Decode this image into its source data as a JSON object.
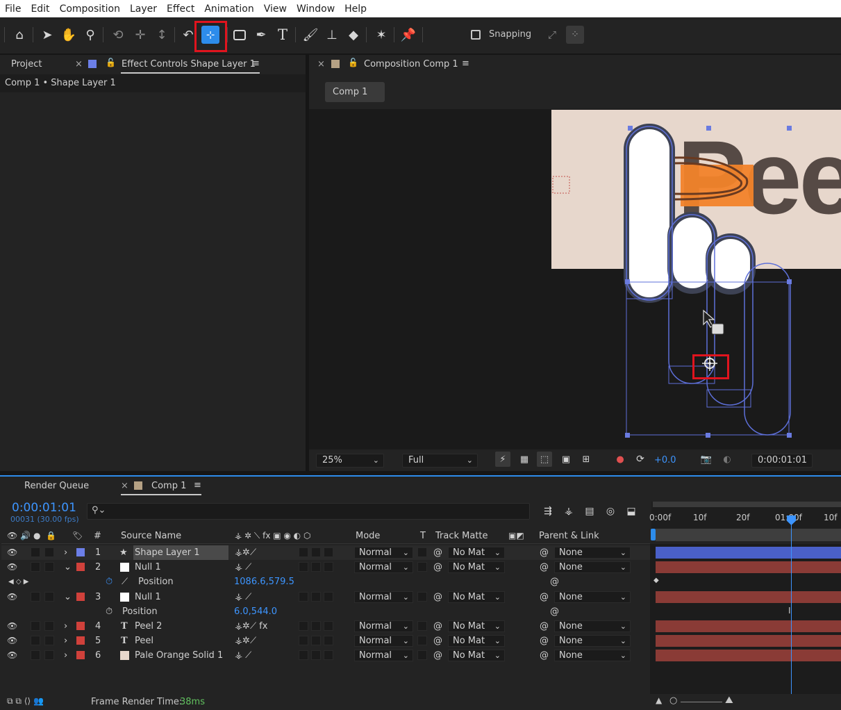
{
  "menu": [
    "File",
    "Edit",
    "Composition",
    "Layer",
    "Effect",
    "Animation",
    "View",
    "Window",
    "Help"
  ],
  "toolbar": {
    "snapping_label": "Snapping"
  },
  "left_panel": {
    "tab_project": "Project",
    "tab_effect_controls": "Effect Controls Shape Layer 1",
    "subtitle": "Comp 1 • Shape Layer 1"
  },
  "comp_panel": {
    "tab_label": "Composition Comp 1",
    "breadcrumb": "Comp 1",
    "canvas_text": "Peel",
    "zoom": "25%",
    "resolution": "Full",
    "exposure": "+0.0",
    "timecode": "0:00:01:01"
  },
  "timeline": {
    "tab_render_queue": "Render Queue",
    "tab_comp": "Comp 1",
    "timecode": "0:00:01:01",
    "frame_info": "00031 (30.00 fps)",
    "ruler": [
      "0:00f",
      "10f",
      "20f",
      "01:00f",
      "10f"
    ],
    "headers": {
      "num": "#",
      "source_name": "Source Name",
      "mode": "Mode",
      "t": "T",
      "track_matte": "Track Matte",
      "parent": "Parent & Link"
    },
    "layers": [
      {
        "num": "1",
        "name": "Shape Layer 1",
        "label_color": "#6c7fe8",
        "mode": "Normal",
        "matte": "No Mat",
        "parent": "None"
      },
      {
        "num": "2",
        "name": "Null 1",
        "label_color": "#d0413b",
        "mode": "Normal",
        "matte": "No Mat",
        "parent": "None"
      },
      {
        "num": "3",
        "name": "Null 1",
        "label_color": "#d0413b",
        "mode": "Normal",
        "matte": "No Mat",
        "parent": "None"
      },
      {
        "num": "4",
        "name": "Peel 2",
        "label_color": "#d0413b",
        "mode": "Normal",
        "matte": "No Mat",
        "parent": "None"
      },
      {
        "num": "5",
        "name": "Peel",
        "label_color": "#d0413b",
        "mode": "Normal",
        "matte": "No Mat",
        "parent": "None"
      },
      {
        "num": "6",
        "name": "Pale Orange Solid 1",
        "label_color": "#d0413b",
        "mode": "Normal",
        "matte": "No Mat",
        "parent": "None"
      }
    ],
    "prop_position_a": {
      "label": "Position",
      "value": "1086.6,579.5"
    },
    "prop_position_b": {
      "label": "Position",
      "value": "6.0,544.0"
    },
    "footer_label": "Frame Render Time:",
    "footer_value": "38ms"
  },
  "colors": {
    "accent_blue": "#2d8ceb",
    "highlight_red": "#e0141e",
    "canvas_bg": "#e7d7cc",
    "bar_red": "#8a3b36",
    "bar_blue": "#4a60c8"
  }
}
